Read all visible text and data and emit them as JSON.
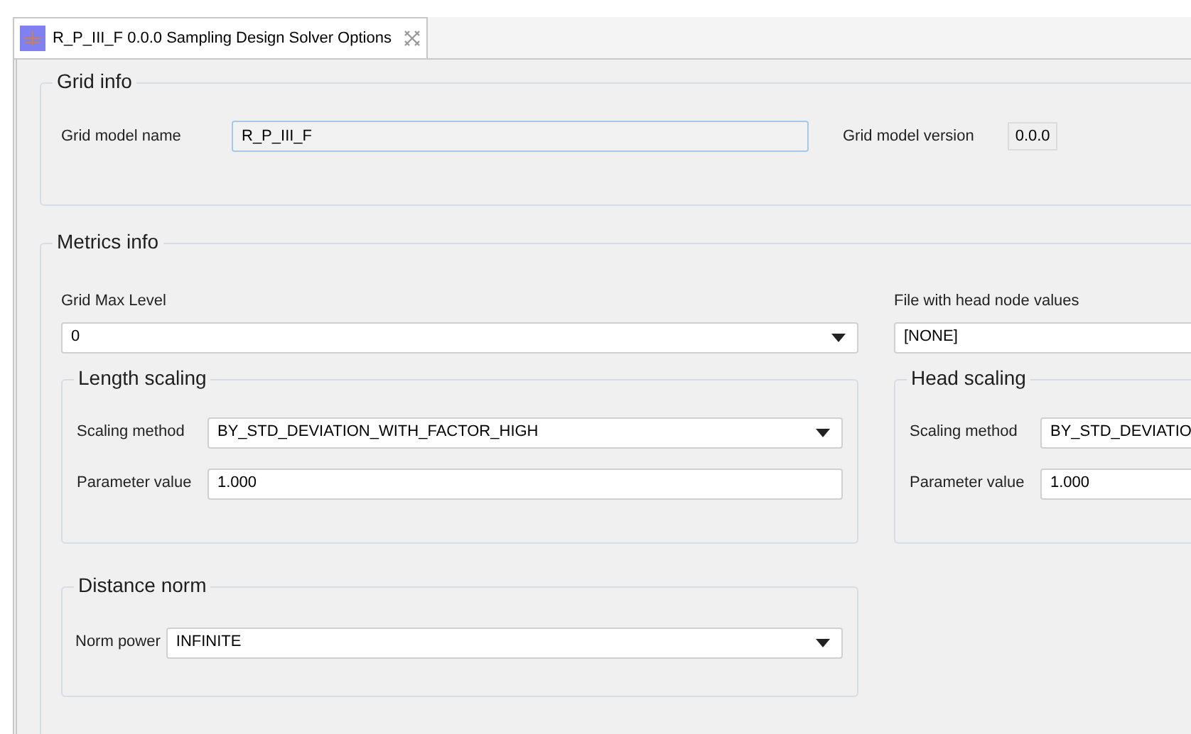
{
  "tab": {
    "title": "R_P_III_F 0.0.0 Sampling Design Solver Options",
    "selected": true
  },
  "grid_info": {
    "title": "Grid info",
    "model_name_label": "Grid model name",
    "model_name": "R_P_III_F",
    "model_version_label": "Grid model version",
    "model_version": "0.0.0"
  },
  "metrics_info": {
    "title": "Metrics info",
    "grid_max_level_label": "Grid Max Level",
    "grid_max_level": "0",
    "head_file_label": "File with head node values",
    "head_file": "[NONE]",
    "length_scaling": {
      "title": "Length scaling",
      "method_label": "Scaling method",
      "method": "BY_STD_DEVIATION_WITH_FACTOR_HIGH",
      "param_label": "Parameter value",
      "param": "1.000"
    },
    "head_scaling": {
      "title": "Head scaling",
      "method_label": "Scaling method",
      "method": "BY_STD_DEVIATIO",
      "param_label": "Parameter value",
      "param": "1.000"
    },
    "distance_norm": {
      "title": "Distance norm",
      "power_label": "Norm power",
      "power": "INFINITE"
    }
  }
}
